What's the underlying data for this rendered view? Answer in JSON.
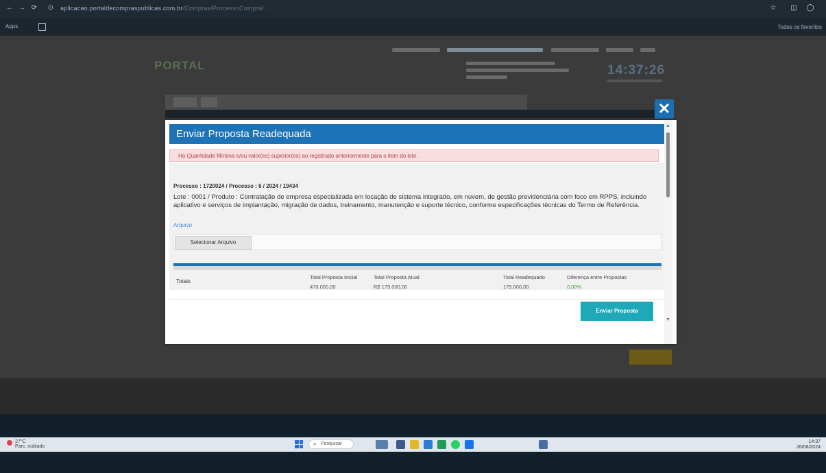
{
  "browser": {
    "url_host": "aplicacao.portaldecompraspublicas.com.br",
    "url_path": "/Compras/ProcessoCompra/...",
    "bookmarks_label": "Apps",
    "bookmarks_right": "Todos os favoritos"
  },
  "page": {
    "logo": "PORTAL",
    "clock": "14:37:26"
  },
  "modal": {
    "title": "Enviar Proposta Readequada",
    "alert": "Há Quantidade Mínima e/ou valor(es) superior(es) ao registrado anteriormente para o item do lote.",
    "process": "Processo : 1720024 / Processo : 6 / 2024 / 19434",
    "lote": "Lote : 0001 / Produto : Contratação de empresa especializada em locação de sistema integrado, em nuvem, de gestão previdenciária com foco em RPPS, incluindo aplicativo e serviços de implantação, migração de dados, treinamento, manutenção e suporte técnico, conforme especificações técnicas do Termo de Referência.",
    "arquivo_label": "Arquivo",
    "file_button": "Selecionar Arquivo",
    "totals_label": "Totais",
    "totals": [
      {
        "head": "Total Proposta Inicial",
        "value": "470.000,00",
        "green": false
      },
      {
        "head": "Total Proposta Atual",
        "value": "R$ 179.000,00",
        "green": false
      },
      {
        "head": "Total Readequado",
        "value": "179.000,00",
        "green": false
      },
      {
        "head": "Diferença entre Propostas",
        "value": "0,00%",
        "green": true
      }
    ],
    "send_button": "Enviar Proposta"
  },
  "taskbar": {
    "weather_temp": "27°C",
    "weather_desc": "Parc. nublado",
    "search": "Pesquisar",
    "time": "14:37",
    "date": "26/06/2024"
  }
}
